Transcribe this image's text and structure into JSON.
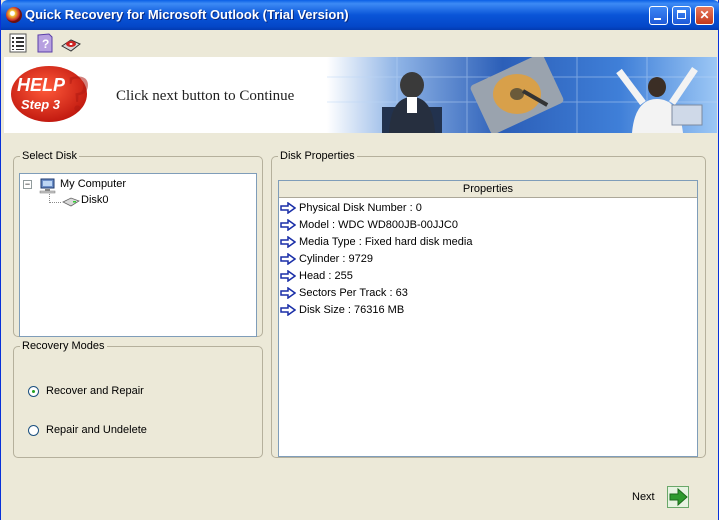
{
  "window": {
    "title": "Quick Recovery for Microsoft Outlook (Trial Version)",
    "minimize_glyph": "_",
    "maximize_glyph": "□",
    "close_glyph": "✕"
  },
  "toolbar": {
    "icons": [
      "list-icon",
      "help-icon",
      "disk-icon"
    ]
  },
  "banner": {
    "help_word": "HELP",
    "step_label": "Step 3",
    "instruction": "Click next button to Continue"
  },
  "select_disk": {
    "legend": "Select Disk",
    "tree": {
      "expander": "−",
      "root": "My Computer",
      "children": [
        "Disk0"
      ]
    }
  },
  "disk_properties": {
    "legend": "Disk Properties",
    "column_header": "Properties",
    "rows": [
      "Physical Disk Number : 0",
      "Model   : WDC WD800JB-00JJC0",
      "Media Type   : Fixed hard disk media",
      "Cylinder   : 9729",
      "Head   : 255",
      "Sectors Per Track    : 63",
      "Disk Size  : 76316 MB"
    ]
  },
  "recovery_modes": {
    "legend": "Recovery Modes",
    "options": [
      {
        "label": "Recover and Repair",
        "selected": true
      },
      {
        "label": "Repair and Undelete",
        "selected": false
      }
    ]
  },
  "footer": {
    "next_label": "Next"
  },
  "colors": {
    "titlebar": "#0a55d8",
    "window_bg": "#ece9d8",
    "close_button": "#c3381c",
    "arrow": "#1a2fa8",
    "next_arrow": "#2e9a2e"
  }
}
